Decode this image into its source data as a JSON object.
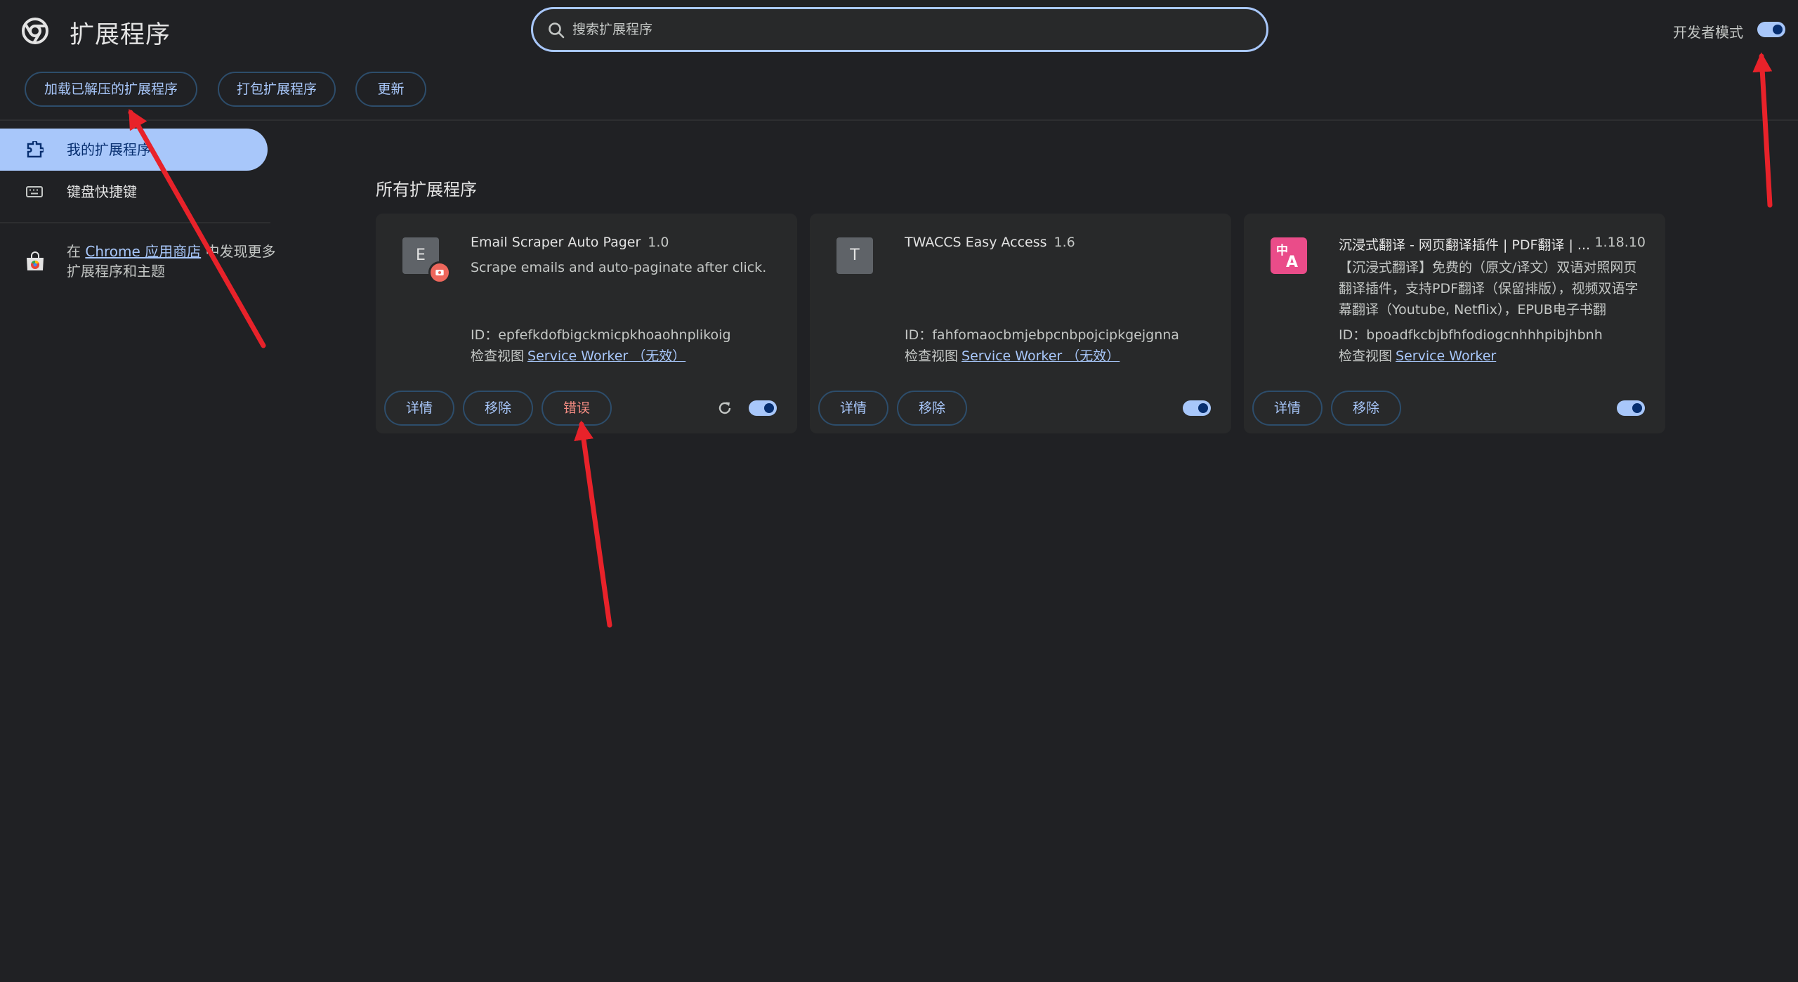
{
  "header": {
    "title": "扩展程序",
    "search_placeholder": "搜索扩展程序",
    "dev_mode_label": "开发者模式",
    "dev_mode_on": true
  },
  "toolbar": {
    "load_unpacked": "加载已解压的扩展程序",
    "pack": "打包扩展程序",
    "update": "更新"
  },
  "sidebar": {
    "items": [
      {
        "label": "我的扩展程序",
        "active": true
      },
      {
        "label": "键盘快捷键",
        "active": false
      }
    ],
    "promo_prefix": "在",
    "promo_link": "Chrome 应用商店",
    "promo_suffix": "中发现更多扩展程序和主题"
  },
  "main": {
    "section_title": "所有扩展程序",
    "cards": [
      {
        "icon_letter": "E",
        "name": "Email Scraper Auto Pager",
        "version": "1.0",
        "description": "Scrape emails and auto-paginate after click.",
        "id_text": "ID：epfefkdofbigckmicpkhoaohnplikoig",
        "inspect_label": "检查视图",
        "inspect_link": "Service Worker （无效）",
        "details_label": "详情",
        "remove_label": "移除",
        "error_label": "错误",
        "enabled": true
      },
      {
        "icon_letter": "T",
        "name": "TWACCS Easy Access",
        "version": "1.6",
        "description": "",
        "id_text": "ID：fahfomaocbmjebpcnbpojcipkgejgnna",
        "inspect_label": "检查视图",
        "inspect_link": "Service Worker （无效）",
        "details_label": "详情",
        "remove_label": "移除",
        "enabled": true
      },
      {
        "name": "沉浸式翻译 - 网页翻译插件 | PDF翻译 | ...",
        "version": "1.18.10",
        "description": "【沉浸式翻译】免费的（原文/译文）双语对照网页翻译插件，支持PDF翻译（保留排版），视频双语字幕翻译（Youtube, Netflix），EPUB电子书翻",
        "id_text": "ID：bpoadfkcbjbfhfodiogcnhhhpibjhbnh",
        "inspect_label": "检查视图",
        "inspect_link": "Service Worker",
        "details_label": "详情",
        "remove_label": "移除",
        "enabled": true
      }
    ]
  },
  "colors": {
    "background": "#202124",
    "accent": "#a8c7fa",
    "error": "#f28b82",
    "annotation": "#e8222a"
  }
}
